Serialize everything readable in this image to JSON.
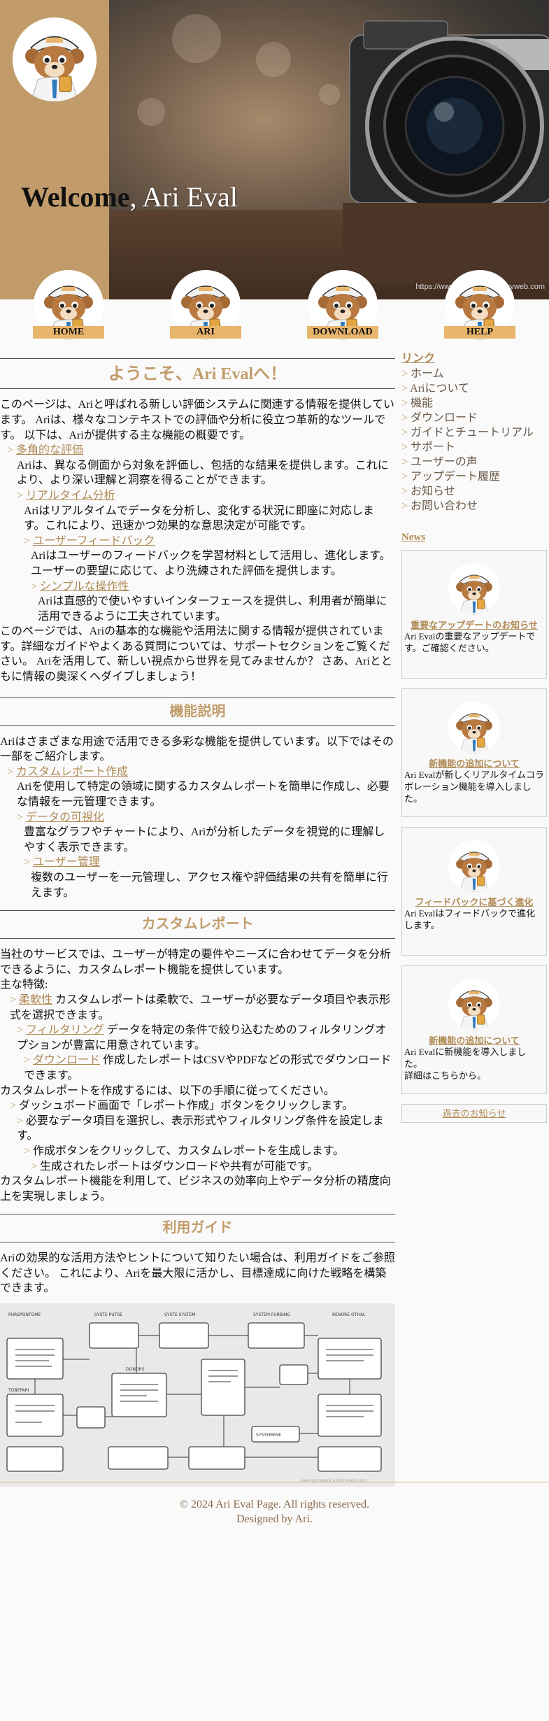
{
  "hero": {
    "welcome_bold": "Welcome",
    "welcome_rest": ", Ari Eval",
    "watermark": "https://www.genspark.ai/ohrvweb.com"
  },
  "nav": [
    {
      "label": "HOME",
      "icon": "mascot-icon"
    },
    {
      "label": "ARI",
      "icon": "mascot-icon"
    },
    {
      "label": "DOWNLOAD",
      "icon": "mascot-icon"
    },
    {
      "label": "HELP",
      "icon": "mascot-icon"
    }
  ],
  "intro": {
    "title": "ようこそ、Ari Evalへ！",
    "p1": "このページは、Ariと呼ばれる新しい評価システムに関連する情報を提供しています。 Ariは、様々なコンテキストでの評価や分析に役立つ革新的なツールです。 以下は、Ariが提供する主な機能の概要です。",
    "items": [
      {
        "title": "多角的な評価",
        "desc": "Ariは、異なる側面から対象を評価し、包括的な結果を提供します。これにより、より深い理解と洞察を得ることができます。"
      },
      {
        "title": "リアルタイム分析",
        "desc": "Ariはリアルタイムでデータを分析し、変化する状況に即座に対応します。これにより、迅速かつ効果的な意思決定が可能です。"
      },
      {
        "title": "ユーザーフィードバック",
        "desc": "Ariはユーザーのフィードバックを学習材料として活用し、進化します。ユーザーの要望に応じて、より洗練された評価を提供します。"
      },
      {
        "title": "シンプルな操作性",
        "desc": "Ariは直感的で使いやすいインターフェースを提供し、利用者が簡単に活用できるように工夫されています。"
      }
    ],
    "p2": "このページでは、Ariの基本的な機能や活用法に関する情報が提供されています。詳細なガイドやよくある質問については、サポートセクションをご覧ください。 Ariを活用して、新しい視点から世界を見てみませんか？ さあ、Ariとともに情報の奥深くへダイブしましょう！"
  },
  "features": {
    "title": "機能説明",
    "p1": "Ariはさまざまな用途で活用できる多彩な機能を提供しています。以下ではその一部をご紹介します。",
    "items": [
      {
        "title": "カスタムレポート作成",
        "desc": "Ariを使用して特定の領域に関するカスタムレポートを簡単に作成し、必要な情報を一元管理できます。"
      },
      {
        "title": "データの可視化",
        "desc": "豊富なグラフやチャートにより、Ariが分析したデータを視覚的に理解しやすく表示できます。"
      },
      {
        "title": "ユーザー管理",
        "desc": "複数のユーザーを一元管理し、アクセス権や評価結果の共有を簡単に行えます。"
      }
    ]
  },
  "reports": {
    "title": "カスタムレポート",
    "p1": "当社のサービスでは、ユーザーが特定の要件やニーズに合わせてデータを分析できるように、カスタムレポート機能を提供しています。",
    "features_label": "主な特徴:",
    "features": [
      {
        "title": "柔軟性",
        "desc": " カスタムレポートは柔軟で、ユーザーが必要なデータ項目や表示形式を選択できます。"
      },
      {
        "title": "フィルタリング",
        "desc": " データを特定の条件で絞り込むためのフィルタリングオプションが豊富に用意されています。"
      },
      {
        "title": "ダウンロード",
        "desc": " 作成したレポートはCSVやPDFなどの形式でダウンロードできます。"
      }
    ],
    "steps_label": "カスタムレポートを作成するには、以下の手順に従ってください。",
    "steps": [
      "ダッシュボード画面で「レポート作成」ボタンをクリックします。",
      "必要なデータ項目を選択し、表示形式やフィルタリング条件を設定します。",
      "作成ボタンをクリックして、カスタムレポートを生成します。",
      "生成されたレポートはダウンロードや共有が可能です。"
    ],
    "p2": "カスタムレポート機能を利用して、ビジネスの効率向上やデータ分析の精度向上を実現しましょう。"
  },
  "guide": {
    "title": "利用ガイド",
    "p1": "Ariの効果的な活用方法やヒントについて知りたい場合は、利用ガイドをご参照ください。 これにより、Ariを最大限に活かし、目標達成に向けた戦略を構築できます。",
    "diagram_labels": [
      "PURSPONTOME",
      "SYSTE PUTSE",
      "SYSTE SYSTEM",
      "SYSTEM FURBING",
      "RENORE OTHAL",
      "DONORS",
      "TOBEPARI",
      "SYSTEMENE"
    ],
    "diagram_watermark": "www.genspark.ai/ohrvweb.com"
  },
  "sidebar": {
    "links_title": "リンク",
    "links": [
      "ホーム",
      "Ariについて",
      "機能",
      "ダウンロード",
      "ガイドとチュートリアル",
      "サポート",
      "ユーザーの声",
      "アップデート履歴",
      "お知らせ",
      "お問い合わせ"
    ],
    "news_title": "News",
    "news": [
      {
        "title": "重要なアップデートのお知らせ",
        "desc": "Ari Evalの重要なアップデートです。ご確認ください。",
        "extra": ""
      },
      {
        "title": "新機能の追加について",
        "desc": "Ari Evalが新しくリアルタイムコラボレーション機能を導入しました。",
        "extra": ""
      },
      {
        "title": "フィードバックに基づく進化",
        "desc": "Ari Evalはフィードバックで進化します。",
        "extra": ""
      },
      {
        "title": "新機能の追加について",
        "desc": "Ari Evalに新機能を導入しました。",
        "extra": "詳細はこちらから。"
      }
    ],
    "past_news": "過去のお知らせ"
  },
  "footer": {
    "copyright": "© 2024 Ari Eval Page. All rights reserved.",
    "designed": "Designed by Ari."
  },
  "colors": {
    "accent": "#c19c6a",
    "nav_label_bg": "#e8b56c",
    "link": "#b08a55"
  }
}
